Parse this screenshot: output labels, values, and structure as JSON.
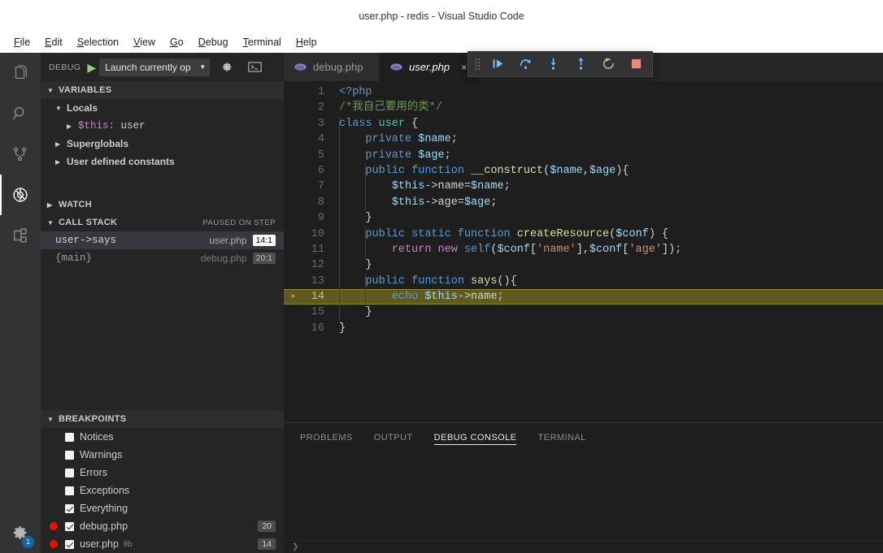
{
  "window": {
    "title": "user.php - redis - Visual Studio Code"
  },
  "menubar": {
    "items": [
      {
        "label": "File",
        "mnemonic": "F"
      },
      {
        "label": "Edit",
        "mnemonic": "E"
      },
      {
        "label": "Selection",
        "mnemonic": "S"
      },
      {
        "label": "View",
        "mnemonic": "V"
      },
      {
        "label": "Go",
        "mnemonic": "G"
      },
      {
        "label": "Debug",
        "mnemonic": "D"
      },
      {
        "label": "Terminal",
        "mnemonic": "T"
      },
      {
        "label": "Help",
        "mnemonic": "H"
      }
    ]
  },
  "activitybar": {
    "items": [
      {
        "icon": "files-explorer-icon",
        "name": "explorer",
        "active": false
      },
      {
        "icon": "search-icon",
        "name": "search",
        "active": false
      },
      {
        "icon": "source-control-icon",
        "name": "scm",
        "active": false
      },
      {
        "icon": "debug-icon",
        "name": "debug",
        "active": true
      },
      {
        "icon": "extensions-icon",
        "name": "extensions",
        "active": false
      }
    ],
    "settings": {
      "icon": "gear-icon",
      "badge": "1"
    }
  },
  "debug_toolbar": {
    "label": "DEBUG",
    "play_icon": "play-icon",
    "configuration": "Launch currently op",
    "caret_icon": "chevron-down-icon",
    "settings_icon": "gear-icon",
    "console_icon": "open-debug-console-icon"
  },
  "debug_float_toolbar": {
    "grip_icon": "drag-handle-icon",
    "buttons": [
      {
        "name": "continue",
        "icon": "continue-icon"
      },
      {
        "name": "step-over",
        "icon": "step-over-icon"
      },
      {
        "name": "step-into",
        "icon": "step-into-icon"
      },
      {
        "name": "step-out",
        "icon": "step-out-icon"
      },
      {
        "name": "restart",
        "icon": "restart-icon"
      },
      {
        "name": "stop",
        "icon": "stop-icon"
      }
    ]
  },
  "sidebar": {
    "variables": {
      "title": "VARIABLES",
      "rows": [
        {
          "label": "Locals",
          "indent": 1,
          "twisty": "down",
          "kind": "scope"
        },
        {
          "name": "$this",
          "value": "user",
          "indent": 2,
          "twisty": "right",
          "kind": "var"
        },
        {
          "label": "Superglobals",
          "indent": 1,
          "twisty": "right",
          "kind": "scope"
        },
        {
          "label": "User defined constants",
          "indent": 1,
          "twisty": "right",
          "kind": "scope"
        }
      ]
    },
    "watch": {
      "title": "WATCH",
      "twisty": "right"
    },
    "callstack": {
      "title": "CALL STACK",
      "status": "PAUSED ON STEP",
      "frames": [
        {
          "name": "user->says",
          "file": "user.php",
          "position": "14:1",
          "selected": true
        },
        {
          "name": "{main}",
          "file": "debug.php",
          "position": "20:1",
          "selected": false
        }
      ]
    },
    "breakpoints": {
      "title": "BREAKPOINTS",
      "rows": [
        {
          "label": "Notices",
          "checked": false,
          "dot": false
        },
        {
          "label": "Warnings",
          "checked": false,
          "dot": false
        },
        {
          "label": "Errors",
          "checked": false,
          "dot": false
        },
        {
          "label": "Exceptions",
          "checked": false,
          "dot": false
        },
        {
          "label": "Everything",
          "checked": true,
          "dot": false
        },
        {
          "label": "debug.php",
          "checked": true,
          "dot": true,
          "count": "20"
        },
        {
          "label": "user.php",
          "sub": "lib",
          "checked": true,
          "dot": true,
          "count": "14"
        }
      ]
    }
  },
  "tabs": [
    {
      "label": "debug.php",
      "icon": "php-file-icon",
      "active": false
    },
    {
      "label": "user.php",
      "icon": "php-file-icon",
      "active": true,
      "close_icon": "close-icon"
    }
  ],
  "editor": {
    "current_line": 14,
    "lines": [
      {
        "n": 1,
        "tokens": [
          {
            "t": "<?php",
            "c": "k"
          }
        ]
      },
      {
        "n": 2,
        "tokens": [
          {
            "t": "/*我自己要用的类*/",
            "c": "cm"
          }
        ]
      },
      {
        "n": 3,
        "tokens": [
          {
            "t": "class ",
            "c": "k"
          },
          {
            "t": "user",
            "c": "ty"
          },
          {
            "t": " {",
            "c": "pn"
          }
        ]
      },
      {
        "n": 4,
        "tokens": [
          {
            "t": "    ",
            "c": "pn"
          },
          {
            "t": "private ",
            "c": "k"
          },
          {
            "t": "$name",
            "c": "vr"
          },
          {
            "t": ";",
            "c": "pn"
          }
        ]
      },
      {
        "n": 5,
        "tokens": [
          {
            "t": "    ",
            "c": "pn"
          },
          {
            "t": "private ",
            "c": "k"
          },
          {
            "t": "$age",
            "c": "vr"
          },
          {
            "t": ";",
            "c": "pn"
          }
        ]
      },
      {
        "n": 6,
        "tokens": [
          {
            "t": "    ",
            "c": "pn"
          },
          {
            "t": "public ",
            "c": "k"
          },
          {
            "t": "function ",
            "c": "k"
          },
          {
            "t": "__construct",
            "c": "fn"
          },
          {
            "t": "(",
            "c": "pn"
          },
          {
            "t": "$name",
            "c": "vr"
          },
          {
            "t": ",",
            "c": "pn"
          },
          {
            "t": "$age",
            "c": "vr"
          },
          {
            "t": "){",
            "c": "pn"
          }
        ]
      },
      {
        "n": 7,
        "tokens": [
          {
            "t": "        ",
            "c": "pn"
          },
          {
            "t": "$this",
            "c": "vr"
          },
          {
            "t": "->name=",
            "c": "pn"
          },
          {
            "t": "$name",
            "c": "vr"
          },
          {
            "t": ";",
            "c": "pn"
          }
        ]
      },
      {
        "n": 8,
        "tokens": [
          {
            "t": "        ",
            "c": "pn"
          },
          {
            "t": "$this",
            "c": "vr"
          },
          {
            "t": "->age=",
            "c": "pn"
          },
          {
            "t": "$age",
            "c": "vr"
          },
          {
            "t": ";",
            "c": "pn"
          }
        ]
      },
      {
        "n": 9,
        "tokens": [
          {
            "t": "    }",
            "c": "pn"
          }
        ]
      },
      {
        "n": 10,
        "tokens": [
          {
            "t": "    ",
            "c": "pn"
          },
          {
            "t": "public ",
            "c": "k"
          },
          {
            "t": "static ",
            "c": "k"
          },
          {
            "t": "function ",
            "c": "k"
          },
          {
            "t": "createResource",
            "c": "fn"
          },
          {
            "t": "(",
            "c": "pn"
          },
          {
            "t": "$conf",
            "c": "vr"
          },
          {
            "t": ") {",
            "c": "pn"
          }
        ]
      },
      {
        "n": 11,
        "tokens": [
          {
            "t": "        ",
            "c": "pn"
          },
          {
            "t": "return ",
            "c": "k2"
          },
          {
            "t": "new ",
            "c": "k2"
          },
          {
            "t": "self",
            "c": "k"
          },
          {
            "t": "(",
            "c": "pn"
          },
          {
            "t": "$conf",
            "c": "vr"
          },
          {
            "t": "[",
            "c": "pn"
          },
          {
            "t": "'name'",
            "c": "st"
          },
          {
            "t": "],",
            "c": "pn"
          },
          {
            "t": "$conf",
            "c": "vr"
          },
          {
            "t": "[",
            "c": "pn"
          },
          {
            "t": "'age'",
            "c": "st"
          },
          {
            "t": "]);",
            "c": "pn"
          }
        ]
      },
      {
        "n": 12,
        "tokens": [
          {
            "t": "    }",
            "c": "pn"
          }
        ]
      },
      {
        "n": 13,
        "tokens": [
          {
            "t": "    ",
            "c": "pn"
          },
          {
            "t": "public ",
            "c": "k"
          },
          {
            "t": "function ",
            "c": "k"
          },
          {
            "t": "says",
            "c": "fn"
          },
          {
            "t": "(){",
            "c": "pn"
          }
        ]
      },
      {
        "n": 14,
        "tokens": [
          {
            "t": "        ",
            "c": "pn"
          },
          {
            "t": "echo ",
            "c": "k"
          },
          {
            "t": "$this",
            "c": "vr"
          },
          {
            "t": "->name",
            "c": "pn"
          },
          {
            "t": ";",
            "c": "pn"
          }
        ],
        "highlight": true,
        "breakpoint_arrow": true
      },
      {
        "n": 15,
        "tokens": [
          {
            "t": "    }",
            "c": "pn"
          }
        ]
      },
      {
        "n": 16,
        "tokens": [
          {
            "t": "}",
            "c": "pn"
          }
        ]
      }
    ]
  },
  "panel": {
    "tabs": [
      {
        "label": "PROBLEMS",
        "active": false
      },
      {
        "label": "OUTPUT",
        "active": false
      },
      {
        "label": "DEBUG CONSOLE",
        "active": true
      },
      {
        "label": "TERMINAL",
        "active": false
      }
    ],
    "prompt_icon": "chevron-right-icon"
  },
  "colors": {
    "titlebar_bg": "#ffffff",
    "sidebar_bg": "#252526",
    "editor_bg": "#1e1e1e",
    "activitybar_bg": "#333333",
    "current_line_highlight": "#5f5a20",
    "breakpoint_red": "#e51400",
    "badge_blue": "#0e70c0",
    "play_green": "#89d185"
  }
}
